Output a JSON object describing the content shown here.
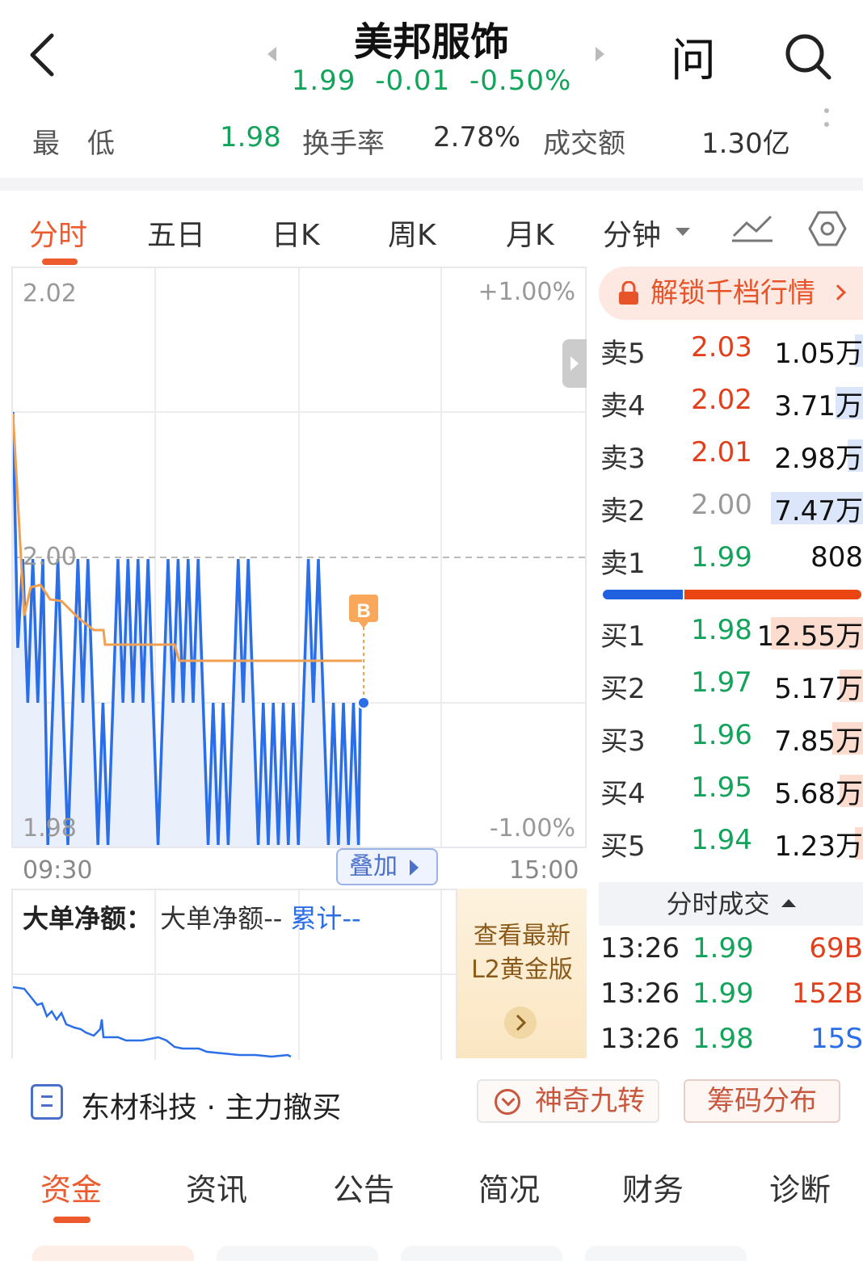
{
  "header": {
    "title": "美邦服饰",
    "price": "1.99",
    "change": "-0.01",
    "change_pct": "-0.50%",
    "ask_label": "问"
  },
  "stats": {
    "low_label": "最　低",
    "low_value": "1.98",
    "turnover_label": "换手率",
    "turnover_value": "2.78%",
    "amount_label": "成交额",
    "amount_value": "1.30亿"
  },
  "tabs": [
    {
      "label": "分时"
    },
    {
      "label": "五日"
    },
    {
      "label": "日K"
    },
    {
      "label": "周K"
    },
    {
      "label": "月K"
    },
    {
      "label": "分钟"
    }
  ],
  "chart": {
    "y_top": "2.02",
    "y_mid": "2.00",
    "y_bot": "1.98",
    "pct_top": "+1.00%",
    "pct_bot": "-1.00%",
    "time_start": "09:30",
    "time_end": "15:00",
    "overlay_label": "叠加",
    "marker_label": "B",
    "colors": {
      "price": "#2a6ee8",
      "avg": "#f0a050",
      "fill": "#e9f0fb"
    }
  },
  "chart_data": {
    "type": "line",
    "x": [
      "09:30",
      "15:00"
    ],
    "ylim": [
      1.98,
      2.02
    ],
    "series": [],
    "grid": true
  },
  "sub_chart": {
    "title": "大单净额",
    "sep": "：",
    "net_label": "大单净额--",
    "cum_label": "累计--"
  },
  "l2_card": {
    "line1": "查看最新",
    "line2": "L2黄金版"
  },
  "order_book": {
    "unlock_label": "解锁千档行情",
    "asks": [
      {
        "label": "卖5",
        "price": "2.03",
        "vol": "1.05万",
        "price_color": "red",
        "bar": 0.05
      },
      {
        "label": "卖4",
        "price": "2.02",
        "vol": "3.71万",
        "price_color": "red",
        "bar": 0.18
      },
      {
        "label": "卖3",
        "price": "2.01",
        "vol": "2.98万",
        "price_color": "red",
        "bar": 0.1
      },
      {
        "label": "卖2",
        "price": "2.00",
        "vol": "7.47万",
        "price_color": "gray",
        "bar": 0.6
      },
      {
        "label": "卖1",
        "price": "1.99",
        "vol": "808",
        "price_color": "green",
        "bar": 0
      }
    ],
    "bids": [
      {
        "label": "买1",
        "price": "1.98",
        "vol": "12.55万",
        "price_color": "green",
        "bar": 0.6
      },
      {
        "label": "买2",
        "price": "1.97",
        "vol": "5.17万",
        "price_color": "green",
        "bar": 0.15
      },
      {
        "label": "买3",
        "price": "1.96",
        "vol": "7.85万",
        "price_color": "green",
        "bar": 0.2
      },
      {
        "label": "买4",
        "price": "1.95",
        "vol": "5.68万",
        "price_color": "green",
        "bar": 0.15
      },
      {
        "label": "买5",
        "price": "1.94",
        "vol": "1.23万",
        "price_color": "green",
        "bar": 0.05
      }
    ],
    "buy_ratio": 0.31
  },
  "trades": {
    "header": "分时成交",
    "rows": [
      {
        "time": "13:26",
        "price": "1.99",
        "vol": "69B",
        "vol_color": "#e0401c"
      },
      {
        "time": "13:26",
        "price": "1.99",
        "vol": "152B",
        "vol_color": "#e0401c"
      },
      {
        "time": "13:26",
        "price": "1.98",
        "vol": "15S",
        "vol_color": "#2a6ee8"
      }
    ]
  },
  "news": {
    "text": "东材科技 · 主力撤买"
  },
  "tools": {
    "nine_turn": "神奇九转",
    "chips": "筹码分布"
  },
  "bottom_tabs": [
    {
      "label": "资金"
    },
    {
      "label": "资讯"
    },
    {
      "label": "公告"
    },
    {
      "label": "简况"
    },
    {
      "label": "财务"
    },
    {
      "label": "诊断"
    }
  ]
}
